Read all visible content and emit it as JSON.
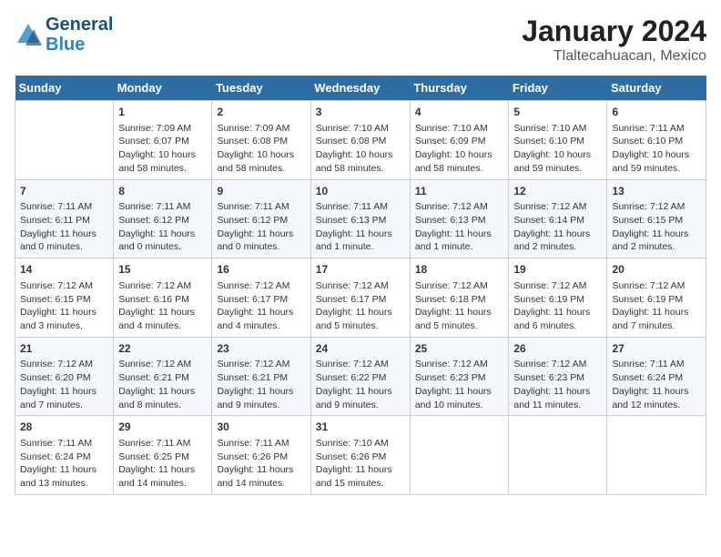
{
  "header": {
    "logo_line1": "General",
    "logo_line2": "Blue",
    "title": "January 2024",
    "subtitle": "Tlaltecahuacan, Mexico"
  },
  "columns": [
    "Sunday",
    "Monday",
    "Tuesday",
    "Wednesday",
    "Thursday",
    "Friday",
    "Saturday"
  ],
  "weeks": [
    [
      {
        "day": "",
        "empty": true
      },
      {
        "day": "1",
        "sunrise": "7:09 AM",
        "sunset": "6:07 PM",
        "daylight": "10 hours and 58 minutes."
      },
      {
        "day": "2",
        "sunrise": "7:09 AM",
        "sunset": "6:08 PM",
        "daylight": "10 hours and 58 minutes."
      },
      {
        "day": "3",
        "sunrise": "7:10 AM",
        "sunset": "6:08 PM",
        "daylight": "10 hours and 58 minutes."
      },
      {
        "day": "4",
        "sunrise": "7:10 AM",
        "sunset": "6:09 PM",
        "daylight": "10 hours and 58 minutes."
      },
      {
        "day": "5",
        "sunrise": "7:10 AM",
        "sunset": "6:10 PM",
        "daylight": "10 hours and 59 minutes."
      },
      {
        "day": "6",
        "sunrise": "7:11 AM",
        "sunset": "6:10 PM",
        "daylight": "10 hours and 59 minutes."
      }
    ],
    [
      {
        "day": "7",
        "sunrise": "7:11 AM",
        "sunset": "6:11 PM",
        "daylight": "11 hours and 0 minutes."
      },
      {
        "day": "8",
        "sunrise": "7:11 AM",
        "sunset": "6:12 PM",
        "daylight": "11 hours and 0 minutes."
      },
      {
        "day": "9",
        "sunrise": "7:11 AM",
        "sunset": "6:12 PM",
        "daylight": "11 hours and 0 minutes."
      },
      {
        "day": "10",
        "sunrise": "7:11 AM",
        "sunset": "6:13 PM",
        "daylight": "11 hours and 1 minute."
      },
      {
        "day": "11",
        "sunrise": "7:12 AM",
        "sunset": "6:13 PM",
        "daylight": "11 hours and 1 minute."
      },
      {
        "day": "12",
        "sunrise": "7:12 AM",
        "sunset": "6:14 PM",
        "daylight": "11 hours and 2 minutes."
      },
      {
        "day": "13",
        "sunrise": "7:12 AM",
        "sunset": "6:15 PM",
        "daylight": "11 hours and 2 minutes."
      }
    ],
    [
      {
        "day": "14",
        "sunrise": "7:12 AM",
        "sunset": "6:15 PM",
        "daylight": "11 hours and 3 minutes."
      },
      {
        "day": "15",
        "sunrise": "7:12 AM",
        "sunset": "6:16 PM",
        "daylight": "11 hours and 4 minutes."
      },
      {
        "day": "16",
        "sunrise": "7:12 AM",
        "sunset": "6:17 PM",
        "daylight": "11 hours and 4 minutes."
      },
      {
        "day": "17",
        "sunrise": "7:12 AM",
        "sunset": "6:17 PM",
        "daylight": "11 hours and 5 minutes."
      },
      {
        "day": "18",
        "sunrise": "7:12 AM",
        "sunset": "6:18 PM",
        "daylight": "11 hours and 5 minutes."
      },
      {
        "day": "19",
        "sunrise": "7:12 AM",
        "sunset": "6:19 PM",
        "daylight": "11 hours and 6 minutes."
      },
      {
        "day": "20",
        "sunrise": "7:12 AM",
        "sunset": "6:19 PM",
        "daylight": "11 hours and 7 minutes."
      }
    ],
    [
      {
        "day": "21",
        "sunrise": "7:12 AM",
        "sunset": "6:20 PM",
        "daylight": "11 hours and 7 minutes."
      },
      {
        "day": "22",
        "sunrise": "7:12 AM",
        "sunset": "6:21 PM",
        "daylight": "11 hours and 8 minutes."
      },
      {
        "day": "23",
        "sunrise": "7:12 AM",
        "sunset": "6:21 PM",
        "daylight": "11 hours and 9 minutes."
      },
      {
        "day": "24",
        "sunrise": "7:12 AM",
        "sunset": "6:22 PM",
        "daylight": "11 hours and 9 minutes."
      },
      {
        "day": "25",
        "sunrise": "7:12 AM",
        "sunset": "6:23 PM",
        "daylight": "11 hours and 10 minutes."
      },
      {
        "day": "26",
        "sunrise": "7:12 AM",
        "sunset": "6:23 PM",
        "daylight": "11 hours and 11 minutes."
      },
      {
        "day": "27",
        "sunrise": "7:11 AM",
        "sunset": "6:24 PM",
        "daylight": "11 hours and 12 minutes."
      }
    ],
    [
      {
        "day": "28",
        "sunrise": "7:11 AM",
        "sunset": "6:24 PM",
        "daylight": "11 hours and 13 minutes."
      },
      {
        "day": "29",
        "sunrise": "7:11 AM",
        "sunset": "6:25 PM",
        "daylight": "11 hours and 14 minutes."
      },
      {
        "day": "30",
        "sunrise": "7:11 AM",
        "sunset": "6:26 PM",
        "daylight": "11 hours and 14 minutes."
      },
      {
        "day": "31",
        "sunrise": "7:10 AM",
        "sunset": "6:26 PM",
        "daylight": "11 hours and 15 minutes."
      },
      {
        "day": "",
        "empty": true
      },
      {
        "day": "",
        "empty": true
      },
      {
        "day": "",
        "empty": true
      }
    ]
  ]
}
